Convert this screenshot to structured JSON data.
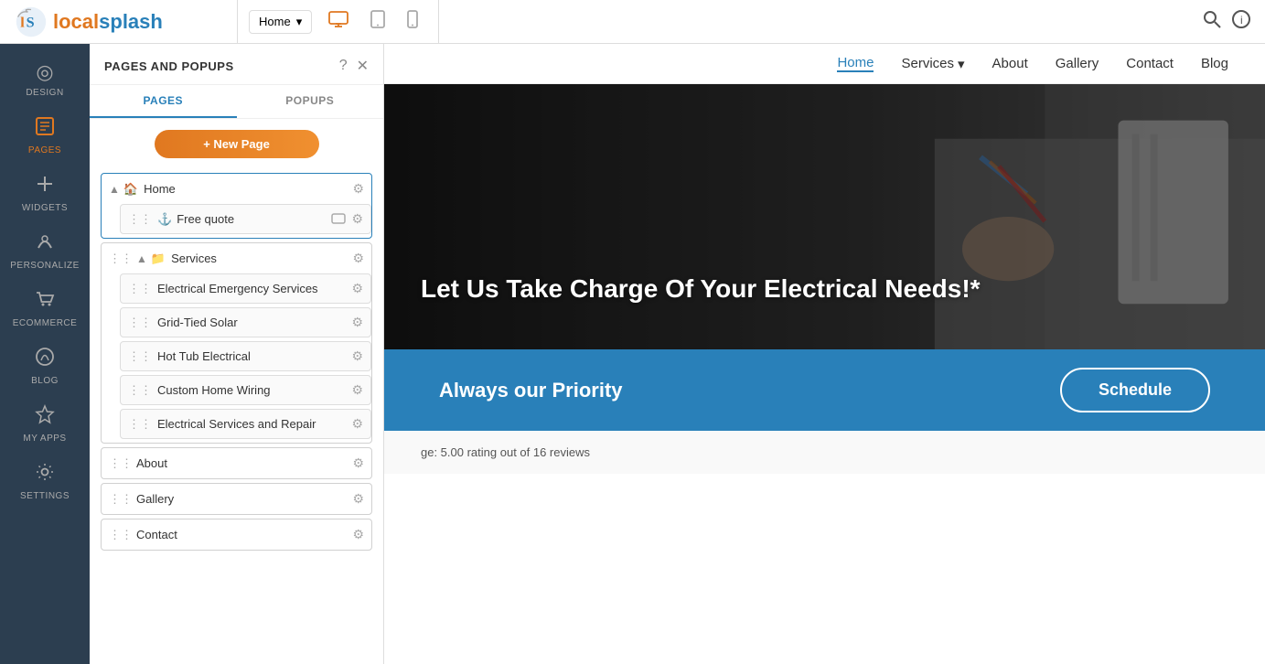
{
  "logo": {
    "local": "local",
    "splash": "splash"
  },
  "toolbar": {
    "page_selector": "Home",
    "device_desktop": "🖥",
    "device_tablet": "📱",
    "device_mobile": "📱"
  },
  "left_sidebar": {
    "items": [
      {
        "id": "design",
        "icon": "◎",
        "label": "DESIGN"
      },
      {
        "id": "pages",
        "icon": "⬜",
        "label": "PAGES"
      },
      {
        "id": "widgets",
        "icon": "+",
        "label": "WIDGETS"
      },
      {
        "id": "personalize",
        "icon": "⤳",
        "label": "PERSONALIZE"
      },
      {
        "id": "ecommerce",
        "icon": "🛒",
        "label": "ECOMMERCE"
      },
      {
        "id": "blog",
        "icon": "💬",
        "label": "BLOG"
      },
      {
        "id": "myapps",
        "icon": "✦",
        "label": "MY APPS"
      },
      {
        "id": "settings",
        "icon": "⚙",
        "label": "SETTINGS"
      }
    ]
  },
  "panel": {
    "title": "PAGES AND POPUPS",
    "help_icon": "?",
    "close_icon": "✕",
    "tabs": [
      {
        "id": "pages",
        "label": "PAGES",
        "active": true
      },
      {
        "id": "popups",
        "label": "POPUPS",
        "active": false
      }
    ],
    "new_page_btn": "+ New Page",
    "pages_tree": [
      {
        "id": "home",
        "label": "Home",
        "icon": "🏠",
        "chevron": "▲",
        "selected": true,
        "children": [
          {
            "id": "free-quote",
            "label": "Free quote",
            "icon": "⚓"
          }
        ]
      },
      {
        "id": "services",
        "label": "Services",
        "icon": "📁",
        "chevron": "▲",
        "selected": false,
        "children": [
          {
            "id": "electrical-emergency",
            "label": "Electrical Emergency Services"
          },
          {
            "id": "grid-tied-solar",
            "label": "Grid-Tied Solar"
          },
          {
            "id": "hot-tub-electrical",
            "label": "Hot Tub Electrical"
          },
          {
            "id": "custom-home-wiring",
            "label": "Custom Home Wiring"
          },
          {
            "id": "electrical-services-repair",
            "label": "Electrical Services and Repair"
          }
        ]
      },
      {
        "id": "about",
        "label": "About",
        "selected": false,
        "children": []
      },
      {
        "id": "gallery",
        "label": "Gallery",
        "selected": false,
        "children": []
      },
      {
        "id": "contact",
        "label": "Contact",
        "selected": false,
        "children": []
      }
    ]
  },
  "website_preview": {
    "nav": {
      "links": [
        {
          "id": "home",
          "label": "Home",
          "active": true
        },
        {
          "id": "services",
          "label": "Services",
          "dropdown": true
        },
        {
          "id": "about",
          "label": "About"
        },
        {
          "id": "gallery",
          "label": "Gallery"
        },
        {
          "id": "contact",
          "label": "Contact"
        },
        {
          "id": "blog",
          "label": "Blog"
        }
      ]
    },
    "hero": {
      "text": "Let Us Take Charge Of Your Electrical Needs!*"
    },
    "cta": {
      "text": "Always our Priority",
      "button_label": "Schedule"
    },
    "bottom": {
      "rating_text": "ge: 5.00 rating out of 16 reviews"
    }
  }
}
